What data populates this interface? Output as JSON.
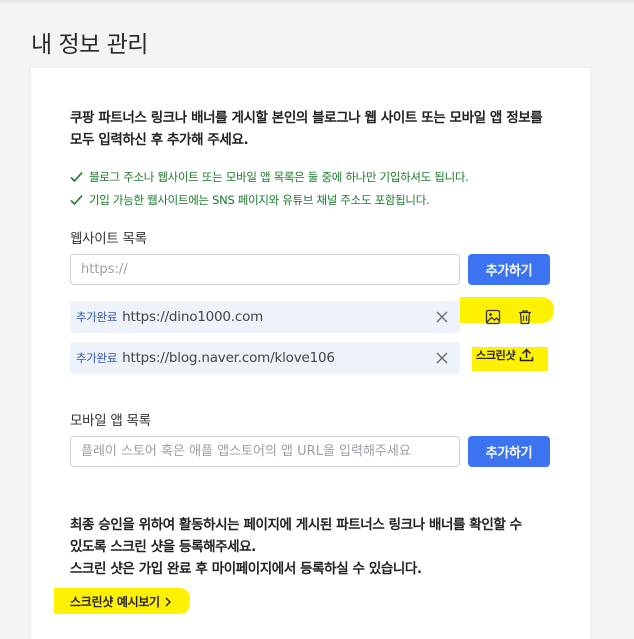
{
  "page": {
    "title": "내 정보 관리"
  },
  "intro": {
    "line1": "쿠팡 파트너스 링크나 배너를 게시할 본인의 블로그나 웹 사이트 또는 모바일 앱 정보를",
    "line2": "모두 입력하신 후 추가해 주세요."
  },
  "notes": [
    "블로그 주소나 웹사이트 또는 모바일 앱 목록은 둘 중에 하나만 기입하셔도 됩니다.",
    "기입 가능한 웹사이트에는 SNS 페이지와 유튜브 채널 주소도 포함됩니다."
  ],
  "website": {
    "label": "웹사이트 목록",
    "placeholder": "https://",
    "add_label": "추가하기",
    "items": [
      {
        "status": "추가완료",
        "url": "https://dino1000.com"
      },
      {
        "status": "추가완료",
        "url": "https://blog.naver.com/klove106"
      }
    ],
    "screenshot_label": "스크린샷"
  },
  "mobile": {
    "label": "모바일 앱 목록",
    "placeholder": "플레이 스토어 혹은 애플 앱스토어의 앱 URL을 입력해주세요",
    "add_label": "추가하기"
  },
  "bottom": {
    "line1": "최종 승인을 위하여 활동하시는 페이지에 게시된 파트너스 링크나 배너를 확인할 수",
    "line2": "있도록 스크린 샷을 등록해주세요.",
    "line3": "스크린 샷은 가입 완료 후 마이페이지에서 등록하실 수 있습니다."
  },
  "preview_link": "스크린샷 예시보기",
  "colors": {
    "primary": "#3b73f0",
    "success": "#1b7a2e",
    "highlight": "#fff200",
    "row_bg": "#eef3fb"
  },
  "icons": [
    "check-icon",
    "close-icon",
    "image-icon",
    "trash-icon",
    "upload-icon",
    "chevron-right-icon"
  ]
}
